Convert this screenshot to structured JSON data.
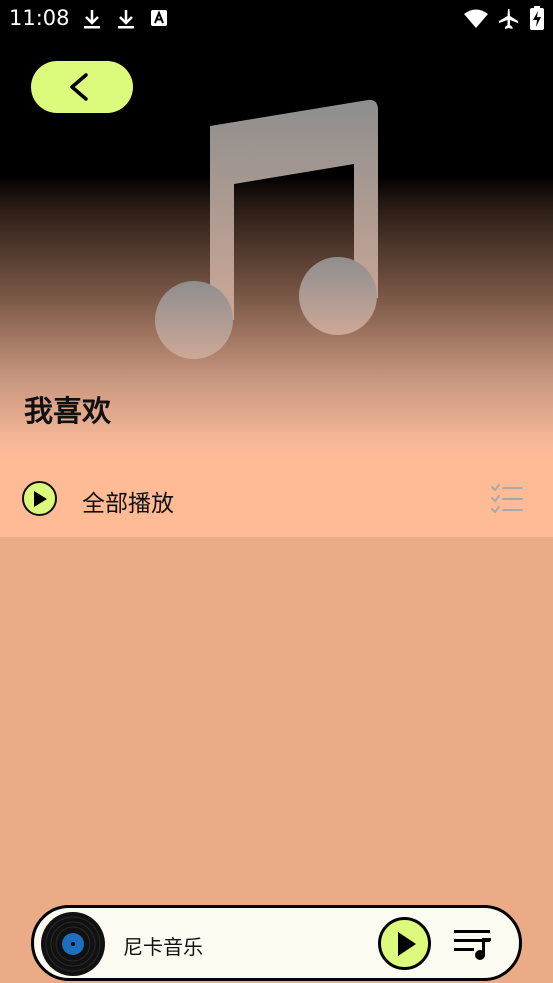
{
  "status_bar": {
    "time": "11:08",
    "icons": [
      "download-icon",
      "download-icon",
      "text-a-icon",
      "wifi-icon",
      "airplane-icon",
      "battery-charging-icon"
    ]
  },
  "header": {
    "back_icon": "chevron-left-icon",
    "cover_icon": "music-note-icon",
    "playlist_title": "我喜欢"
  },
  "play_all": {
    "label": "全部播放",
    "play_icon": "play-icon",
    "select_icon": "checklist-icon"
  },
  "mini_player": {
    "song_title": "尼卡音乐",
    "disc_icon": "vinyl-disc-icon",
    "play_icon": "play-icon",
    "queue_icon": "playlist-music-icon"
  },
  "colors": {
    "accent": "#dcfb7c",
    "row_bg": "#ffbb96",
    "page_bg": "#ebab87",
    "header_top": "#000000"
  }
}
